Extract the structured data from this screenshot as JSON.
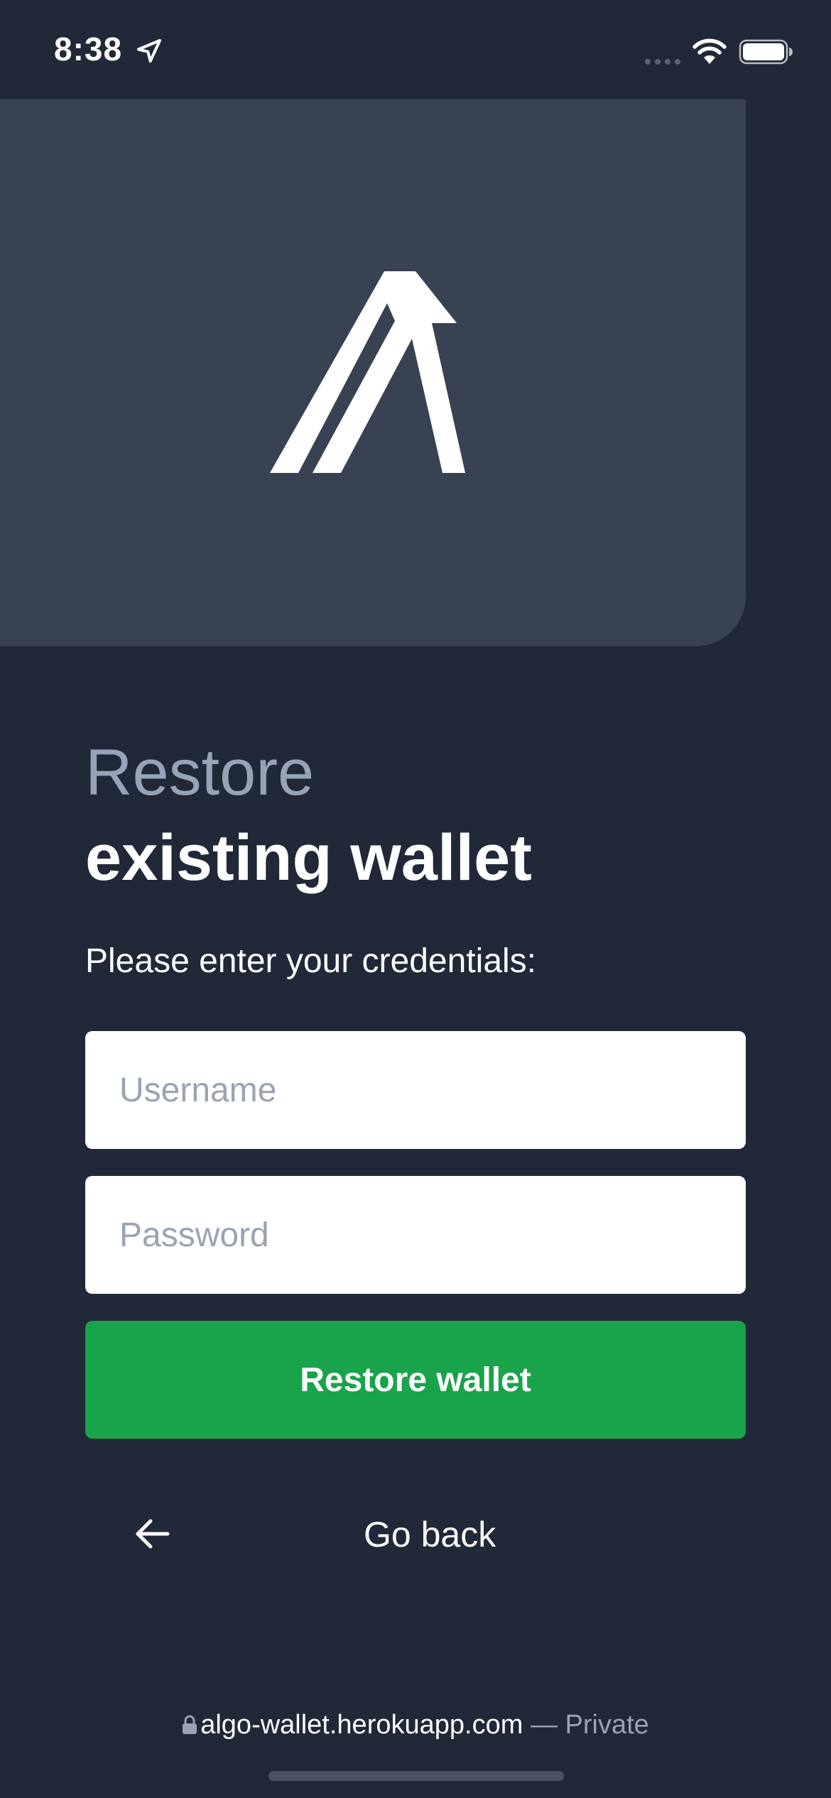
{
  "status_bar": {
    "time": "8:38",
    "location_icon": "location-arrow-icon",
    "signal_icon": "cellular-signal-icon",
    "wifi_icon": "wifi-icon",
    "battery_icon": "battery-icon"
  },
  "hero": {
    "logo_icon": "algorand-logo-icon"
  },
  "heading": {
    "line1": "Restore",
    "line2": "existing wallet"
  },
  "form": {
    "instructions": "Please enter your credentials:",
    "username_placeholder": "Username",
    "username_value": "",
    "password_placeholder": "Password",
    "password_value": "",
    "submit_label": "Restore wallet"
  },
  "nav": {
    "back_label": "Go back",
    "back_icon": "arrow-left-icon"
  },
  "browser": {
    "lock_icon": "lock-icon",
    "domain": "algo-wallet.herokuapp.com",
    "suffix": "— Private"
  },
  "colors": {
    "background": "#212938",
    "hero": "#394253",
    "accent_green": "#19a34a",
    "muted_text": "#97a3b8"
  }
}
